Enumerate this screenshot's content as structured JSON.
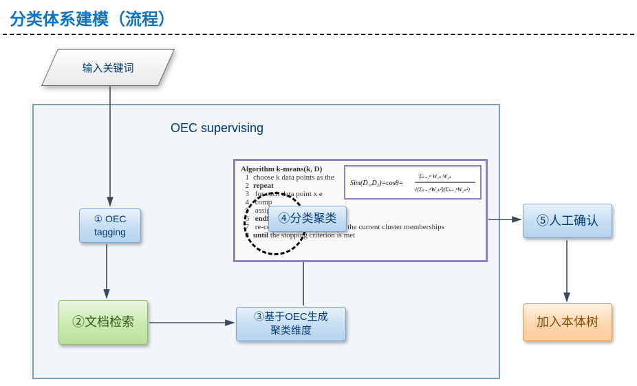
{
  "header": {
    "title": "分类体系建模（流程）"
  },
  "input": {
    "label": "输入关键词"
  },
  "zone": {
    "title": "OEC supervising"
  },
  "steps": {
    "tag": {
      "label": "① OEC\ntagging"
    },
    "search": {
      "label": "②文档检索"
    },
    "dim": {
      "label": "③基于OEC生成\n聚类维度"
    },
    "cluster": {
      "label": "④分类聚类"
    },
    "confirm": {
      "label": "⑤人工确认"
    },
    "tree": {
      "label": "加入本体树"
    }
  },
  "algorithm": {
    "title": "Algorithm k-means(k, D)",
    "lines": [
      "choose k data points as the",
      "repeat",
      "  for each data point x e",
      "    comp",
      "    assig                                                 troid represents a cluster",
      "  endfor",
      "  re-compute the centroid using the current cluster memberships",
      "until the stopping criterion is met"
    ],
    "formula_tex": "Sim(D_1,D_2)=cos\\theta=\\frac{\\sum_{k=1}^{n}W_{1k}\\cdot W_{2k}}{\\sqrt{(\\sum_{k=1}^{n}W_{1k}^2)(\\sum_{k=1}^{n}W_{2k}^2)}}"
  }
}
